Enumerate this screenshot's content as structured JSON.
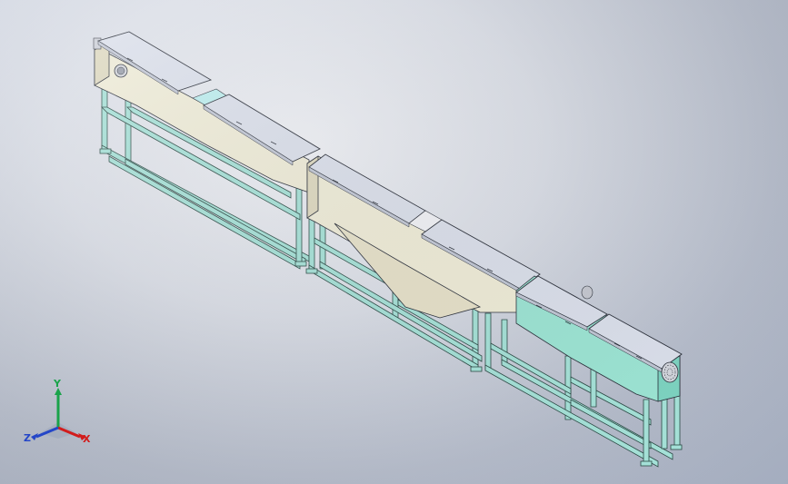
{
  "viewport": {
    "background_top": "#f4f6fb",
    "background_bottom": "#a4adbf"
  },
  "model": {
    "colors": {
      "frame": "#a8e6dc",
      "frame_edge": "#2b4a45",
      "beige_body": "#f4f1dc",
      "beige_dark": "#e2ddc3",
      "cover": "#dfe4f0",
      "cover_edge": "#2a2f3a",
      "teal_body": "#9fe9d8",
      "teal_dark": "#7fd7c4",
      "gap_cyan": "#bff3f4"
    }
  },
  "triad": {
    "x_label": "X",
    "y_label": "Y",
    "z_label": "Z",
    "x_color": "#d21c1c",
    "y_color": "#1aa34a",
    "z_color": "#2446c8"
  }
}
